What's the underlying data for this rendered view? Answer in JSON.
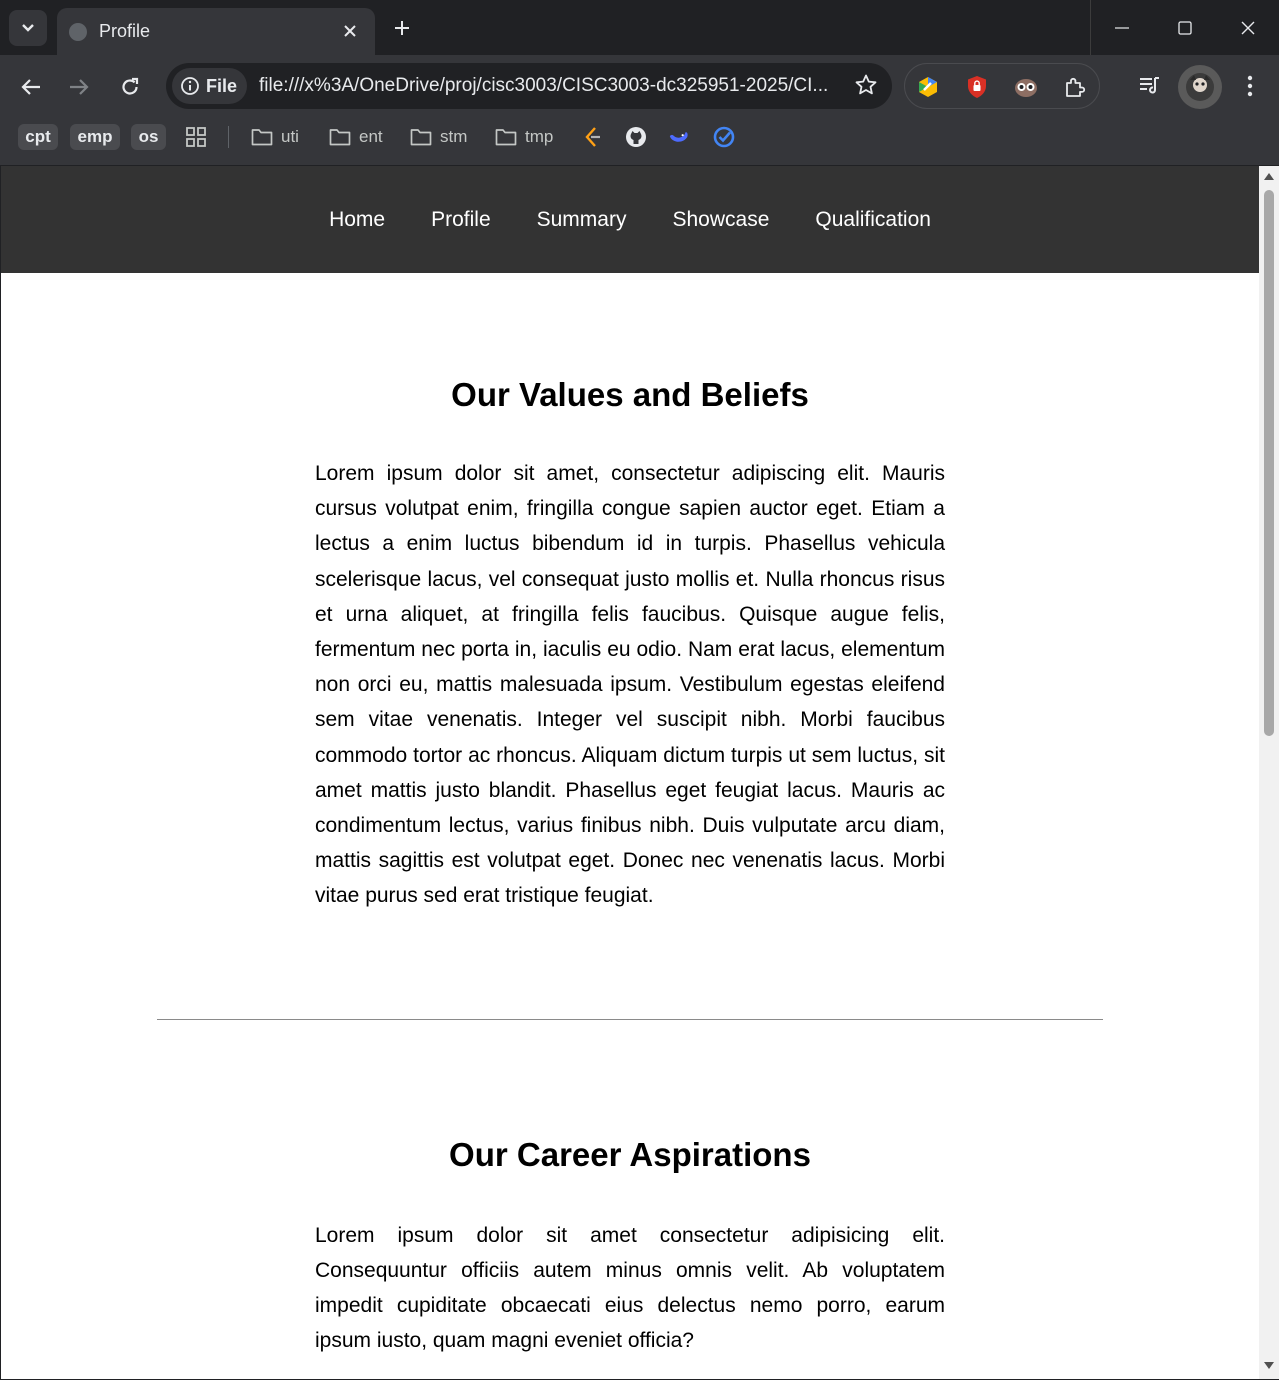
{
  "browser": {
    "tab_title": "Profile",
    "url_chip_label": "File",
    "url": "file:///x%3A/OneDrive/proj/cisc3003/CISC3003-dc325951-2025/CI...",
    "bookmarks": {
      "pills": [
        "cpt",
        "emp",
        "os"
      ],
      "folders": [
        "uti",
        "ent",
        "stm",
        "tmp"
      ]
    }
  },
  "site": {
    "nav": [
      "Home",
      "Profile",
      "Summary",
      "Showcase",
      "Qualification"
    ]
  },
  "sections": [
    {
      "heading": "Our Values and Beliefs",
      "body": "Lorem ipsum dolor sit amet, consectetur adipiscing elit. Mauris cursus volutpat enim, fringilla congue sapien auctor eget. Etiam a lectus a enim luctus bibendum id in turpis. Phasellus vehicula scelerisque lacus, vel consequat justo mollis et. Nulla rhoncus risus et urna aliquet, at fringilla felis faucibus. Quisque augue felis, fermentum nec porta in, iaculis eu odio. Nam erat lacus, elementum non orci eu, mattis malesuada ipsum. Vestibulum egestas eleifend sem vitae venenatis. Integer vel suscipit nibh. Morbi faucibus commodo tortor ac rhoncus. Aliquam dictum turpis ut sem luctus, sit amet mattis justo blandit. Phasellus eget feugiat lacus. Mauris ac condimentum lectus, varius finibus nibh. Duis vulputate arcu diam, mattis sagittis est volutpat eget. Donec nec venenatis lacus. Morbi vitae purus sed erat tristique feugiat."
    },
    {
      "heading": "Our Career Aspirations",
      "body": "Lorem ipsum dolor sit amet consectetur adipisicing elit. Consequuntur officiis autem minus omnis velit. Ab voluptatem impedit cupiditate obcaecati eius delectus nemo porro, earum ipsum iusto, quam magni eveniet officia?"
    }
  ],
  "colors": {
    "chrome_dark": "#202124",
    "chrome_toolbar": "#35363a",
    "site_nav_bg": "#333333"
  }
}
